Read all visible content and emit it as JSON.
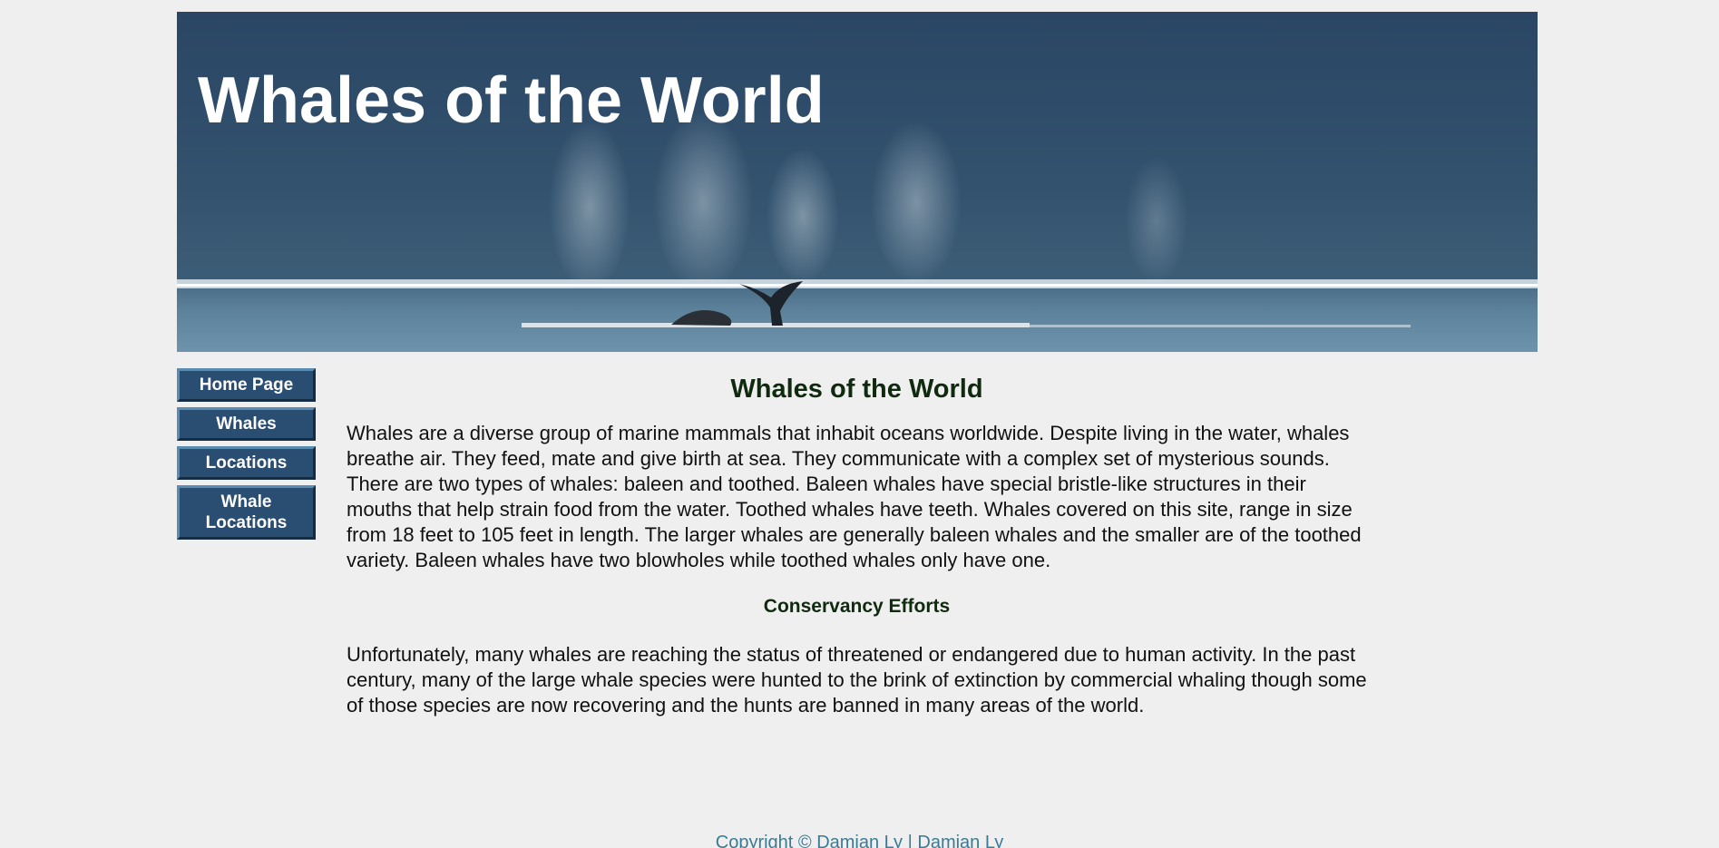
{
  "banner": {
    "title": "Whales of the World"
  },
  "nav": {
    "items": [
      {
        "label": "Home Page"
      },
      {
        "label": "Whales"
      },
      {
        "label": "Locations"
      },
      {
        "label": "Whale Locations"
      }
    ]
  },
  "main": {
    "title": "Whales of the World",
    "intro": "Whales are a diverse group of marine mammals that inhabit oceans worldwide. Despite living in the water, whales breathe air. They feed, mate and give birth at sea. They communicate with a complex set of mysterious sounds. There are two types of whales: baleen and toothed. Baleen whales have special bristle-like structures in their mouths that help strain food from the water. Toothed whales have teeth. Whales covered on this site, range in size from 18 feet to 105 feet in length. The larger whales are generally baleen whales and the smaller are of the toothed variety. Baleen whales have two blowholes while toothed whales only have one.",
    "conservancy_title": "Conservancy Efforts",
    "conservancy_text": "Unfortunately, many whales are reaching the status of threatened or endangered due to human activity. In the past century, many of the large whale species were hunted to the brink of extinction by commercial whaling though some of those species are now recovering and the hunts are banned in many areas of the world."
  },
  "footer": {
    "prefix": "Copyright © ",
    "author_link_1": "Damian Ly",
    "separator": " | ",
    "author_link_2": "Damian Ly"
  },
  "colors": {
    "background": "#efefef",
    "nav_button": "#2a4d72",
    "heading": "#0f2a0f",
    "footer_link": "#3a7b94"
  }
}
